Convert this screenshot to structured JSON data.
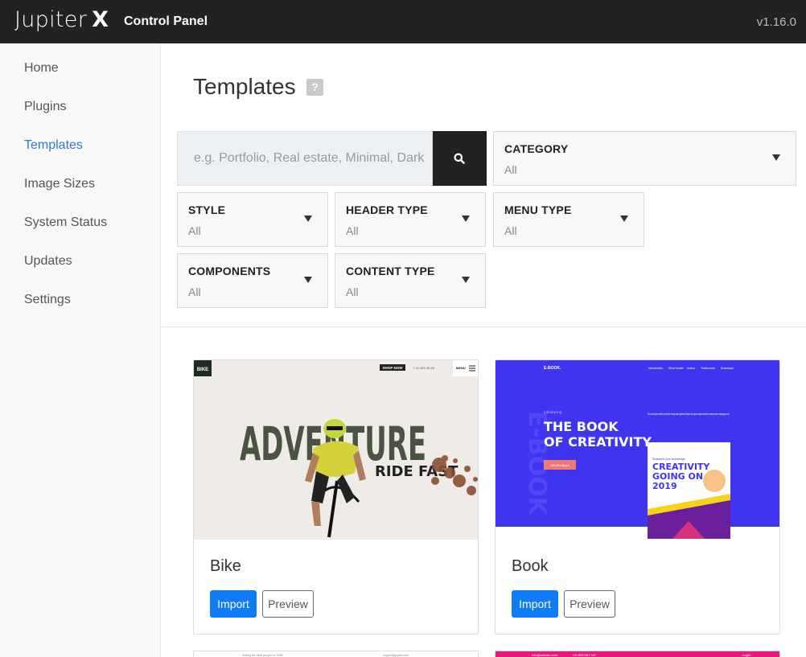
{
  "header": {
    "logo_text": "Jupiter",
    "logo_x": "X",
    "panel_title": "Control Panel",
    "version": "v1.16.0"
  },
  "sidebar": {
    "items": [
      {
        "label": "Home",
        "active": false
      },
      {
        "label": "Plugins",
        "active": false
      },
      {
        "label": "Templates",
        "active": true
      },
      {
        "label": "Image Sizes",
        "active": false
      },
      {
        "label": "System Status",
        "active": false
      },
      {
        "label": "Updates",
        "active": false
      },
      {
        "label": "Settings",
        "active": false
      }
    ]
  },
  "main": {
    "title": "Templates",
    "help_glyph": "?",
    "search": {
      "placeholder": "e.g. Portfolio, Real estate, Minimal, Dark",
      "value": ""
    },
    "filters": {
      "category": {
        "label": "CATEGORY",
        "value": "All"
      },
      "style": {
        "label": "STYLE",
        "value": "All"
      },
      "header_type": {
        "label": "HEADER TYPE",
        "value": "All"
      },
      "menu_type": {
        "label": "MENU TYPE",
        "value": "All"
      },
      "components": {
        "label": "COMPONENTS",
        "value": "All"
      },
      "content_type": {
        "label": "CONTENT TYPE",
        "value": "All"
      }
    },
    "templates": [
      {
        "name": "Bike",
        "import_label": "Import",
        "preview_label": "Preview",
        "thumb": {
          "logo": "BIKE",
          "shop_button": "SHOP NOW",
          "phone": "+ 02 489 45 45",
          "menu": "MENU",
          "headline": "ADVENTURE",
          "subline": "RIDE FAST"
        }
      },
      {
        "name": "Book",
        "import_label": "Import",
        "preview_label": "Preview",
        "thumb": {
          "logo": "E-BOOK.",
          "nav": [
            "Introduction",
            "What Inside",
            "Author",
            "Testimonial",
            "Download"
          ],
          "intro": "Introducing",
          "headline_1": "THE BOOK",
          "headline_2": "OF CREATIVITY",
          "button": "Get the Book",
          "quote": "Fowl moved green whales years below moving female gathered darkness won't green winged creature the dominion above beginning moved.",
          "cover_kicker": "Research your knowledge",
          "cover_title_1": "CREATIVITY",
          "cover_title_2": "GOING ON",
          "cover_title_3": "2019",
          "side_text": "E-BOOK"
        }
      }
    ],
    "peek": {
      "left_text_1": "Setting the ideal people for 1998",
      "left_text_2": "support@jupiter.com",
      "right_email": "info@domain.com",
      "right_phone": "+00 825 567 347",
      "right_login": "Login"
    }
  },
  "colors": {
    "topbar": "#222222",
    "accent_active": "#2f7ad6",
    "import_button": "#0f7cf3",
    "book_bg": "#3f34f0",
    "peek_bar": "#e8187f"
  }
}
